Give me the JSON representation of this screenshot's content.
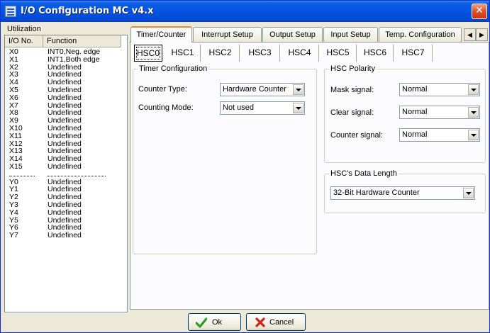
{
  "window": {
    "title": "I/O Configuration MC v4.x",
    "close_glyph": "✕"
  },
  "utilization": {
    "caption": "Utilization",
    "headers": [
      "I/O No.",
      "Function"
    ],
    "rows": [
      [
        "X0",
        "INT0,Neg. edge"
      ],
      [
        "X1",
        "INT1,Both edge"
      ],
      [
        "X2",
        "Undefined"
      ],
      [
        "X3",
        "Undefined"
      ],
      [
        "X4",
        "Undefined"
      ],
      [
        "X5",
        "Undefined"
      ],
      [
        "X6",
        "Undefined"
      ],
      [
        "X7",
        "Undefined"
      ],
      [
        "X8",
        "Undefined"
      ],
      [
        "X9",
        "Undefined"
      ],
      [
        "X10",
        "Undefined"
      ],
      [
        "X11",
        "Undefined"
      ],
      [
        "X12",
        "Undefined"
      ],
      [
        "X13",
        "Undefined"
      ],
      [
        "X14",
        "Undefined"
      ],
      [
        "X15",
        "Undefined"
      ],
      [
        "",
        ""
      ],
      [
        "Y0",
        "Undefined"
      ],
      [
        "Y1",
        "Undefined"
      ],
      [
        "Y2",
        "Undefined"
      ],
      [
        "Y3",
        "Undefined"
      ],
      [
        "Y4",
        "Undefined"
      ],
      [
        "Y5",
        "Undefined"
      ],
      [
        "Y6",
        "Undefined"
      ],
      [
        "Y7",
        "Undefined"
      ]
    ]
  },
  "main_tabs": [
    "Timer/Counter",
    "Interrupt Setup",
    "Output Setup",
    "Input Setup",
    "Temp. Configuration"
  ],
  "tab_scroll": {
    "left": "◀",
    "right": "▶"
  },
  "sub_tabs": [
    "HSC0",
    "HSC1",
    "HSC2",
    "HSC3",
    "HSC4",
    "HSC5",
    "HSC6",
    "HSC7"
  ],
  "timer_config": {
    "caption": "Timer Configuration",
    "counter_type_label": "Counter Type:",
    "counter_type_value": "Hardware Counter",
    "counting_mode_label": "Counting Mode:",
    "counting_mode_value": "Not used"
  },
  "hsc_polarity": {
    "caption": "HSC Polarity",
    "mask_label": "Mask signal:",
    "mask_value": "Normal",
    "clear_label": "Clear signal:",
    "clear_value": "Normal",
    "counter_label": "Counter signal:",
    "counter_value": "Normal"
  },
  "data_length": {
    "caption": "HSC's Data Length",
    "value": "32-Bit Hardware Counter"
  },
  "buttons": {
    "ok": "Ok",
    "cancel": "Cancel"
  },
  "colors": {
    "ok_check": "#2f9a2a",
    "cancel_x": "#d8201a",
    "active_tab_accent": "#e68b2c"
  }
}
